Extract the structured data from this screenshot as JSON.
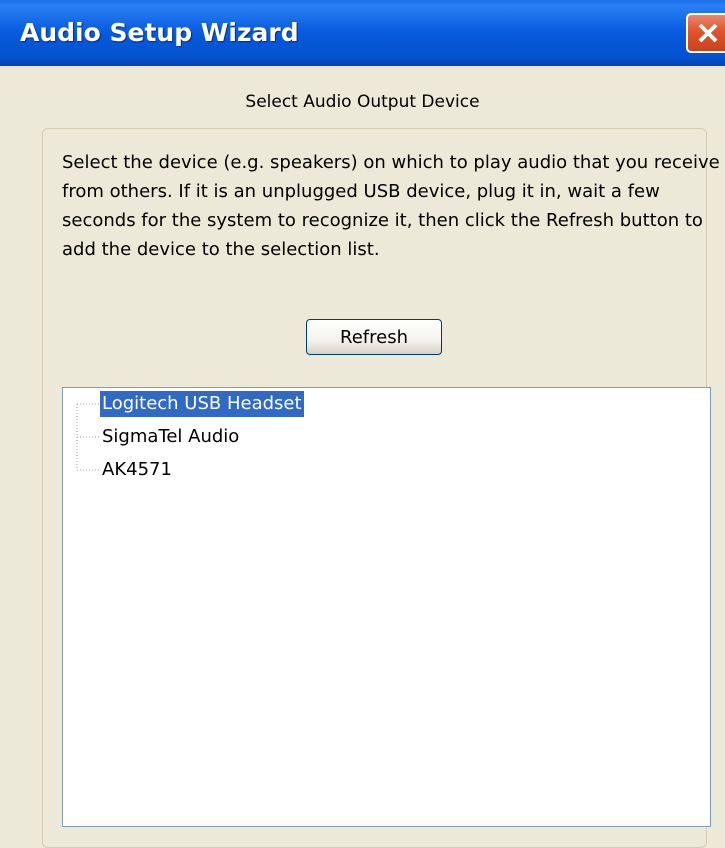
{
  "window": {
    "title": "Audio Setup Wizard",
    "close_icon": "close-icon"
  },
  "page": {
    "heading": "Select Audio Output Device",
    "description": "Select the device (e.g. speakers) on which to play audio that you receive from others.  If it is an unplugged USB device, plug it in, wait a few seconds for the system to recognize it, then click the Refresh button to add the device to the selection list.",
    "refresh_label": "Refresh"
  },
  "devices": {
    "items": [
      {
        "label": "Logitech USB Headset",
        "selected": true
      },
      {
        "label": "SigmaTel Audio",
        "selected": false
      },
      {
        "label": "AK4571",
        "selected": false
      }
    ]
  },
  "colors": {
    "titlebar": "#0a5ee0",
    "selection": "#316ac5",
    "close_button": "#e0542c"
  }
}
